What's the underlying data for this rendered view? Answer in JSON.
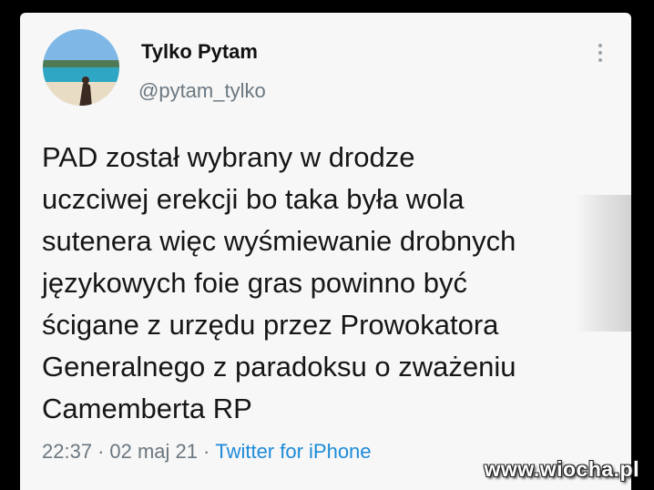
{
  "tweet": {
    "display_name": "Tylko Pytam",
    "handle": "@pytam_tylko",
    "lines": [
      "PAD został wybrany w drodze",
      "uczciwej erekcji bo taka była wola",
      "sutenera więc wyśmiewanie drobnych",
      "językowych foie gras powinno być",
      "ścigane z urzędu przez Prowokatora",
      "Generalnego z paradoksu o zważeniu",
      "Camemberta RP"
    ],
    "time": "22:37",
    "date": "02 maj 21",
    "separator": "·",
    "source": "Twitter for iPhone"
  },
  "watermark": "www.wiocha.pl",
  "icons": {
    "more": "vertical-dots-icon",
    "avatar": "beach-photo-avatar"
  },
  "colors": {
    "link": "#1d8bd8",
    "secondary_text": "#6b7780",
    "card_bg": "#f7f7f7"
  }
}
